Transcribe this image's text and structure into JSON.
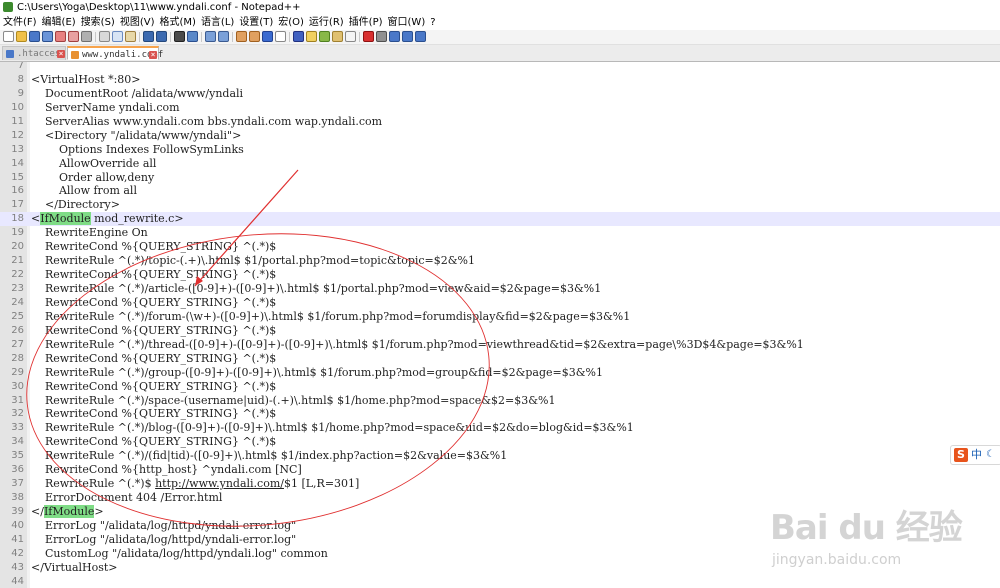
{
  "window": {
    "title": "C:\\Users\\Yoga\\Desktop\\11\\www.yndali.conf - Notepad++"
  },
  "menu": [
    "文件(F)",
    "编辑(E)",
    "搜索(S)",
    "视图(V)",
    "格式(M)",
    "语言(L)",
    "设置(T)",
    "宏(O)",
    "运行(R)",
    "插件(P)",
    "窗口(W)",
    "?"
  ],
  "tabs": [
    {
      "label": ".htaccess",
      "state": "inactive"
    },
    {
      "label": "www.yndali.conf",
      "state": "active"
    }
  ],
  "editor": {
    "current_line": 18,
    "lines": [
      {
        "n": "7",
        "text": ""
      },
      {
        "n": "8",
        "text": "<VirtualHost *:80>"
      },
      {
        "n": "9",
        "text": "    DocumentRoot /alidata/www/yndali"
      },
      {
        "n": "10",
        "text": "    ServerName yndali.com"
      },
      {
        "n": "11",
        "text": "    ServerAlias www.yndali.com bbs.yndali.com wap.yndali.com"
      },
      {
        "n": "12",
        "text": "    <Directory \"/alidata/www/yndali\">"
      },
      {
        "n": "13",
        "text": "        Options Indexes FollowSymLinks"
      },
      {
        "n": "14",
        "text": "        AllowOverride all"
      },
      {
        "n": "15",
        "text": "        Order allow,deny"
      },
      {
        "n": "16",
        "text": "        Allow from all"
      },
      {
        "n": "17",
        "text": "    </Directory>"
      },
      {
        "n": "18",
        "pre": "<",
        "hl": "IfModule",
        "post": " mod_rewrite.c>"
      },
      {
        "n": "19",
        "text": "    RewriteEngine On"
      },
      {
        "n": "20",
        "text": "    RewriteCond %{QUERY_STRING} ^(.*)$"
      },
      {
        "n": "21",
        "text": "    RewriteRule ^(.*)/topic-(.+)\\.html$ $1/portal.php?mod=topic&topic=$2&%1"
      },
      {
        "n": "22",
        "text": "    RewriteCond %{QUERY_STRING} ^(.*)$"
      },
      {
        "n": "23",
        "text": "    RewriteRule ^(.*)/article-([0-9]+)-([0-9]+)\\.html$ $1/portal.php?mod=view&aid=$2&page=$3&%1"
      },
      {
        "n": "24",
        "text": "    RewriteCond %{QUERY_STRING} ^(.*)$"
      },
      {
        "n": "25",
        "text": "    RewriteRule ^(.*)/forum-(\\w+)-([0-9]+)\\.html$ $1/forum.php?mod=forumdisplay&fid=$2&page=$3&%1"
      },
      {
        "n": "26",
        "text": "    RewriteCond %{QUERY_STRING} ^(.*)$"
      },
      {
        "n": "27",
        "text": "    RewriteRule ^(.*)/thread-([0-9]+)-([0-9]+)-([0-9]+)\\.html$ $1/forum.php?mod=viewthread&tid=$2&extra=page\\%3D$4&page=$3&%1"
      },
      {
        "n": "28",
        "text": "    RewriteCond %{QUERY_STRING} ^(.*)$"
      },
      {
        "n": "29",
        "text": "    RewriteRule ^(.*)/group-([0-9]+)-([0-9]+)\\.html$ $1/forum.php?mod=group&fid=$2&page=$3&%1"
      },
      {
        "n": "30",
        "text": "    RewriteCond %{QUERY_STRING} ^(.*)$"
      },
      {
        "n": "31",
        "text": "    RewriteRule ^(.*)/space-(username|uid)-(.+)\\.html$ $1/home.php?mod=space&$2=$3&%1"
      },
      {
        "n": "32",
        "text": "    RewriteCond %{QUERY_STRING} ^(.*)$"
      },
      {
        "n": "33",
        "text": "    RewriteRule ^(.*)/blog-([0-9]+)-([0-9]+)\\.html$ $1/home.php?mod=space&uid=$2&do=blog&id=$3&%1"
      },
      {
        "n": "34",
        "text": "    RewriteCond %{QUERY_STRING} ^(.*)$"
      },
      {
        "n": "35",
        "text": "    RewriteRule ^(.*)/(fid|tid)-([0-9]+)\\.html$ $1/index.php?action=$2&value=$3&%1"
      },
      {
        "n": "36",
        "text": "    RewriteCond %{http_host} ^yndali.com [NC]"
      },
      {
        "n": "37",
        "pre": "    RewriteRule ^(.*)$ ",
        "link": "http://www.yndali.com/",
        "post": "$1 [L,R=301]"
      },
      {
        "n": "38",
        "text": "    ErrorDocument 404 /Error.html"
      },
      {
        "n": "39",
        "pre": "</",
        "hl": "IfModule",
        "post": ">"
      },
      {
        "n": "40",
        "text": "    ErrorLog \"/alidata/log/httpd/yndali-error.log\""
      },
      {
        "n": "41",
        "text": "    ErrorLog \"/alidata/log/httpd/yndali-error.log\""
      },
      {
        "n": "42",
        "text": "    CustomLog \"/alidata/log/httpd/yndali.log\" common"
      },
      {
        "n": "43",
        "text": "</VirtualHost>"
      },
      {
        "n": "44",
        "text": ""
      }
    ]
  },
  "ime": {
    "brand_letter": "S",
    "mode": "中"
  },
  "watermark": {
    "brand": "Bai du 经验",
    "url": "jingyan.baidu.com"
  },
  "colors": {
    "annotation": "#e03030",
    "match_highlight": "#7fdc86",
    "current_line": "#e8e8ff",
    "active_tab_accent": "#f7a34b"
  }
}
